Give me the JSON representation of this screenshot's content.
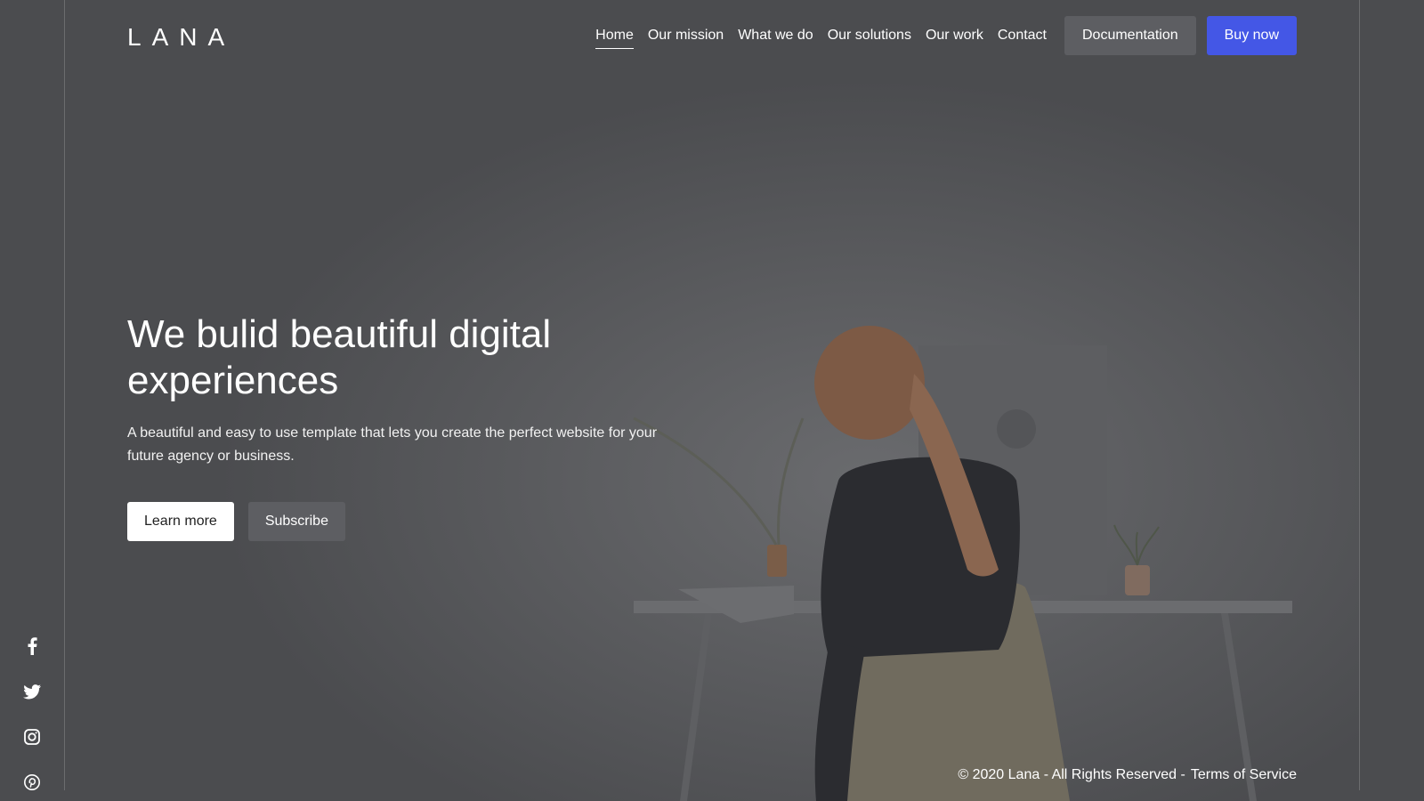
{
  "brand": {
    "logo_text": "LANA"
  },
  "nav": {
    "items": [
      {
        "label": "Home",
        "active": true
      },
      {
        "label": "Our mission"
      },
      {
        "label": "What we do"
      },
      {
        "label": "Our solutions"
      },
      {
        "label": "Our work"
      },
      {
        "label": "Contact"
      }
    ],
    "documentation_label": "Documentation",
    "buy_label": "Buy now"
  },
  "hero": {
    "title": "We bulid beautiful digital experiences",
    "text": "A beautiful and easy to use template that lets you create the perfect website for your future agency or business.",
    "primary_label": "Learn more",
    "secondary_label": "Subscribe"
  },
  "social": [
    {
      "icon": "facebook-icon"
    },
    {
      "icon": "twitter-icon"
    },
    {
      "icon": "instagram-icon"
    },
    {
      "icon": "pinterest-icon"
    }
  ],
  "footer": {
    "copyright": "© 2020 Lana - All Rights Reserved -",
    "terms_label": "Terms of Service"
  },
  "colors": {
    "background": "#4b4c4f",
    "accent": "#4457e6",
    "secondary_button": "#5d5e62"
  }
}
